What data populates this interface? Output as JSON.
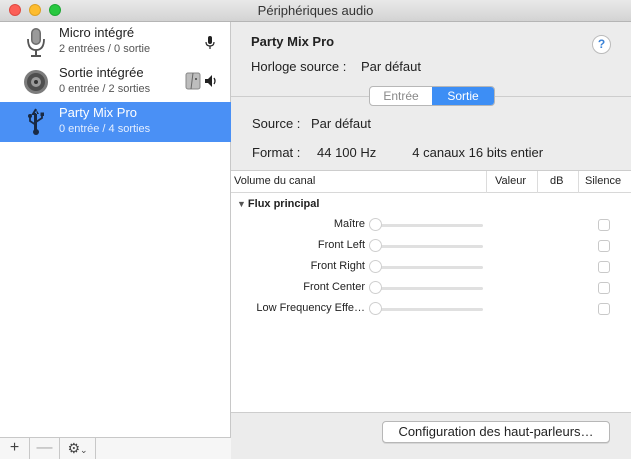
{
  "window": {
    "title": "Périphériques audio"
  },
  "devices": [
    {
      "name": "Micro intégré",
      "sub": "2 entrées / 0 sortie",
      "icon": "microphone-icon",
      "right_icon": "input-mic-icon"
    },
    {
      "name": "Sortie intégrée",
      "sub": "0 entrée / 2 sorties",
      "icon": "speaker-icon",
      "right_icon": "finder-icon"
    },
    {
      "name": "Party Mix Pro",
      "sub": "0 entrée / 4 sorties",
      "icon": "usb-icon",
      "selected": true
    }
  ],
  "sidebar_bottom": {
    "add": "+",
    "remove": "—",
    "gear": "⚙"
  },
  "detail": {
    "title": "Party Mix Pro",
    "help": "?",
    "clock_label": "Horloge source :",
    "clock_value": "Par défaut",
    "tabs": [
      "Entrée",
      "Sortie"
    ],
    "active_tab": "Sortie",
    "source_label": "Source :",
    "source_value": "Par défaut",
    "format_label": "Format :",
    "format_rate": "44 100 Hz",
    "format_channels": "4 canaux 16 bits entier"
  },
  "table": {
    "headers": [
      "Volume du canal",
      "Valeur",
      "dB",
      "Silence"
    ],
    "group": "Flux principal",
    "channels": [
      "Maître",
      "Front Left",
      "Front Right",
      "Front Center",
      "Low Frequency Effe…"
    ]
  },
  "config_button": "Configuration des haut-parleurs…",
  "colors": {
    "selection": "#4a90f5",
    "accent": "#3d8ef5"
  }
}
